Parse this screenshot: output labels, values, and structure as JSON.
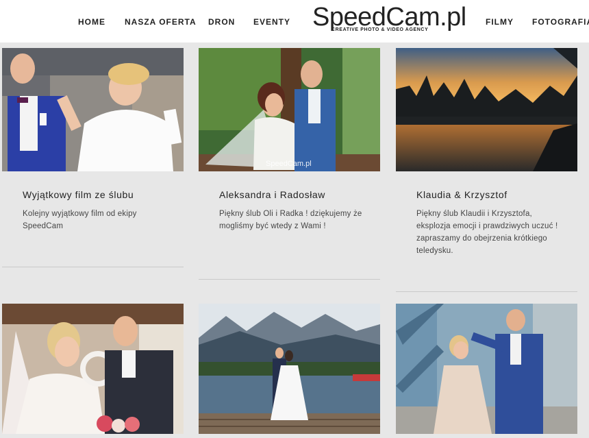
{
  "nav": {
    "left": [
      "HOME",
      "NASZA OFERTA",
      "DRON",
      "EVENTY"
    ],
    "right": [
      "FILMY",
      "FOTOGRAFIA"
    ]
  },
  "logo": {
    "text": "SpeedCam.pl",
    "tagline": "CREATIVE PHOTO & VIDEO AGENCY"
  },
  "cards": [
    {
      "title": "Wyjątkowy film ze ślubu",
      "description": "Kolejny wyjątkowy film od ekipy SpeedCam",
      "image": "couple-celebrating-photo"
    },
    {
      "title": "Aleksandra i Radosław",
      "description": "Piękny ślub Oli i Radka ! dziękujemy że mogliśmy być wtedy z Wami !",
      "image": "couple-on-bench-photo",
      "watermark": "SpeedCam.pl"
    },
    {
      "title": "Klaudia & Krzysztof",
      "description": "Piękny ślub Klaudii i Krzysztofa, eksplozja emocji i prawdziwych uczuć ! zapraszamy do obejrzenia krótkiego teledysku.",
      "image": "lake-sunset-photo"
    },
    {
      "image": "bride-and-groom-flowers-photo"
    },
    {
      "image": "mountain-lake-couple-photo"
    },
    {
      "image": "couple-on-bridge-photo"
    }
  ]
}
